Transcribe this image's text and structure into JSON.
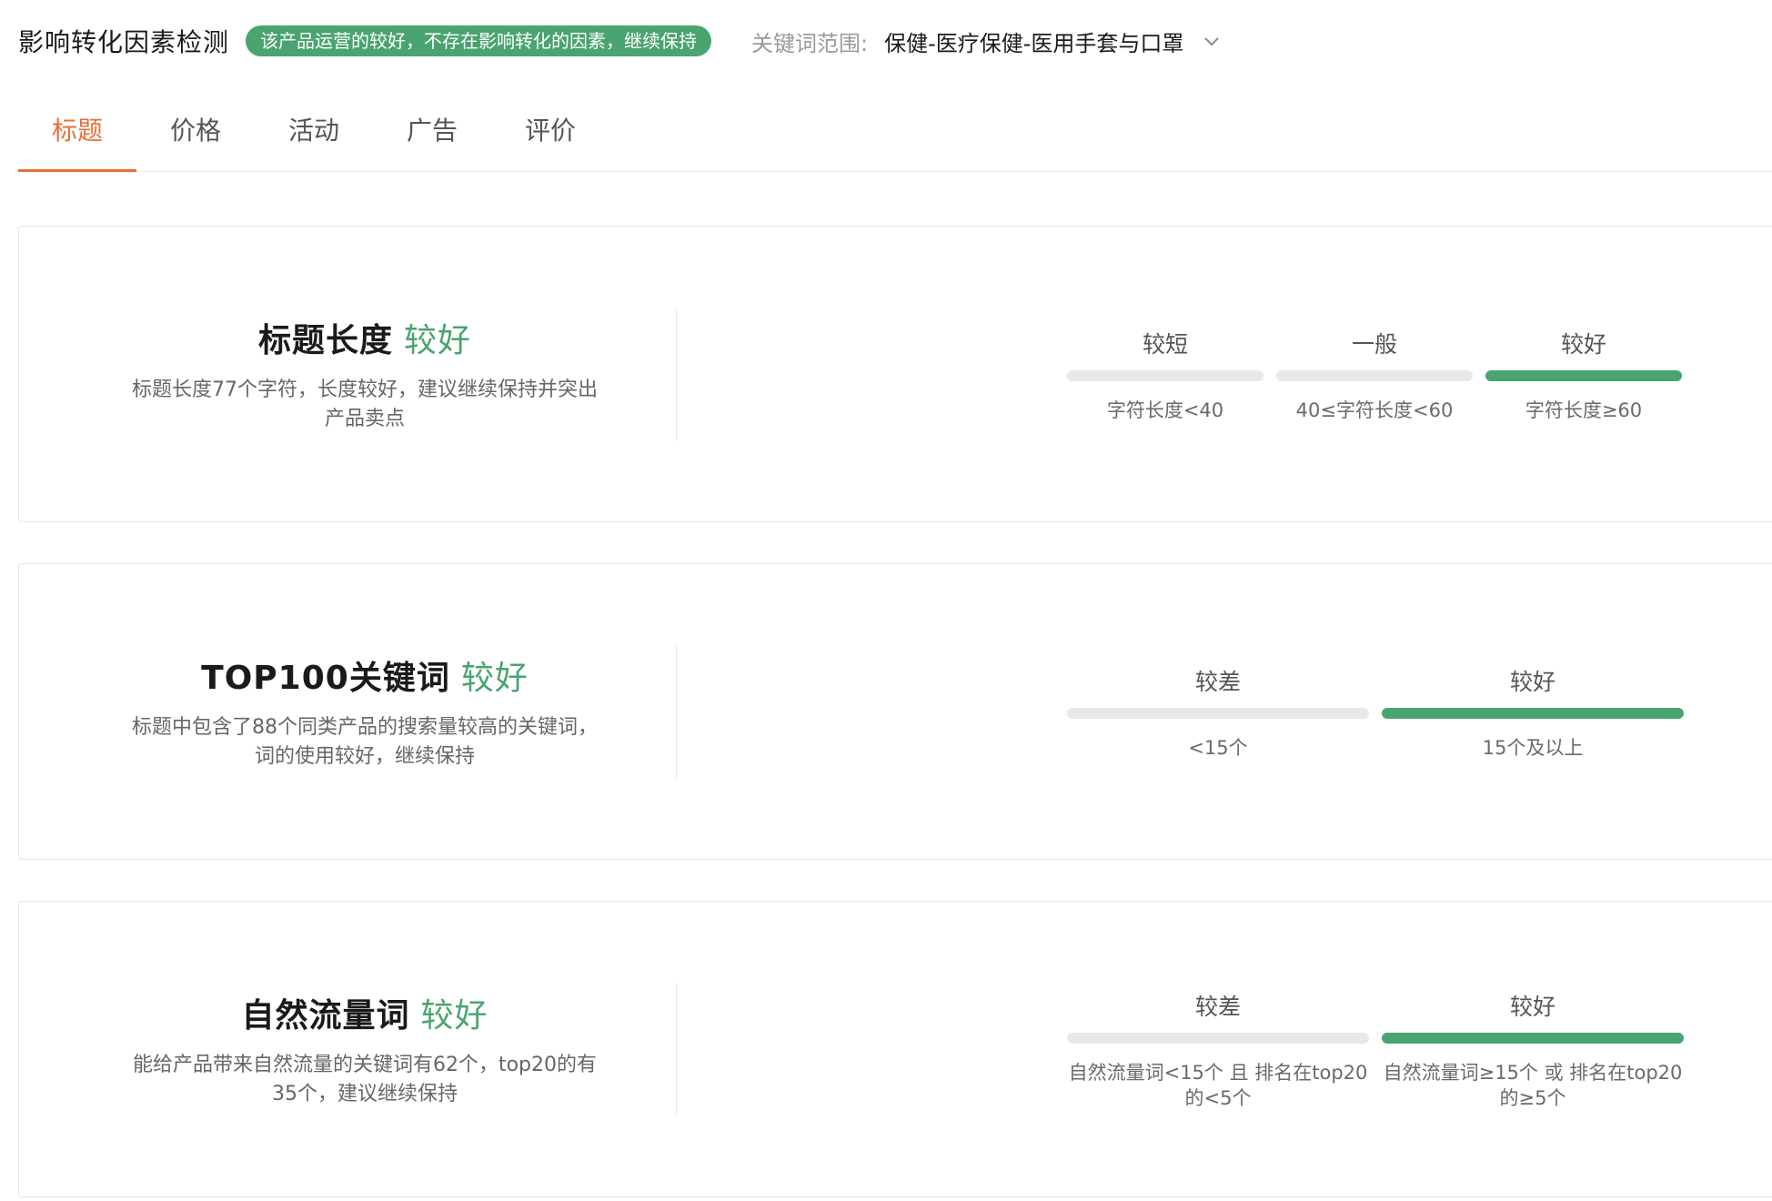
{
  "header": {
    "title": "影响转化因素检测",
    "status_badge": "该产品运营的较好，不存在影响转化的因素，继续保持",
    "scope_label": "关键词范围:",
    "scope_value": "保健-医疗保健-医用手套与口罩"
  },
  "tabs": [
    {
      "label": "标题",
      "active": true
    },
    {
      "label": "价格",
      "active": false
    },
    {
      "label": "活动",
      "active": false
    },
    {
      "label": "广告",
      "active": false
    },
    {
      "label": "评价",
      "active": false
    }
  ],
  "colors": {
    "accent": "#e6703a",
    "good": "#4aa46f",
    "bar_inactive": "#e8e8e8"
  },
  "cards": [
    {
      "name": "标题长度",
      "grade": "较好",
      "description": "标题长度77个字符，长度较好，建议继续保持并突出产品卖点",
      "levels": [
        {
          "label": "较短",
          "condition": "字符长度<40",
          "active": false
        },
        {
          "label": "一般",
          "condition": "40≤字符长度<60",
          "active": false
        },
        {
          "label": "较好",
          "condition": "字符长度≥60",
          "active": true
        }
      ]
    },
    {
      "name": "TOP100关键词",
      "grade": "较好",
      "description": "标题中包含了88个同类产品的搜索量较高的关键词，词的使用较好，继续保持",
      "levels": [
        {
          "label": "较差",
          "condition": "<15个",
          "active": false
        },
        {
          "label": "较好",
          "condition": "15个及以上",
          "active": true
        }
      ]
    },
    {
      "name": "自然流量词",
      "grade": "较好",
      "description": "能给产品带来自然流量的关键词有62个，top20的有35个，建议继续保持",
      "levels": [
        {
          "label": "较差",
          "condition": "自然流量词<15个 且 排名在top20的<5个",
          "active": false
        },
        {
          "label": "较好",
          "condition": "自然流量词≥15个 或 排名在top20的≥5个",
          "active": true
        }
      ]
    }
  ]
}
